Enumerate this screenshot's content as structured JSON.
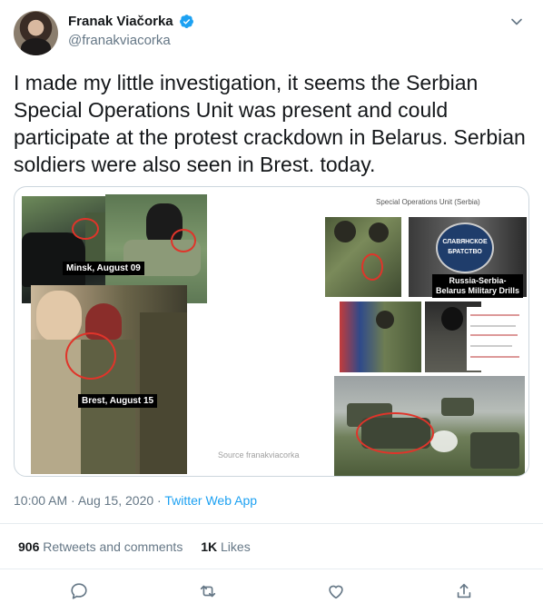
{
  "author": {
    "display_name": "Franak Viačorka",
    "handle": "@franakviacorka",
    "verified": true
  },
  "tweet": {
    "text": "I made my little investigation, it seems the Serbian Special Operations Unit was present and could participate at the protest crackdown in Belarus. Serbian soldiers were also seen in Brest. today."
  },
  "media": {
    "labels": {
      "minsk": "Minsk, August 09",
      "brest": "Brest, August 15",
      "source": "Source franakviacorka",
      "unit_title": "Special Operations Unit (Serbia)",
      "drills": "Russia-Serbia-\nBelarus Military Drills",
      "badge_top": "СЛАВЯНСКОЕ",
      "badge_bottom": "БРАТСТВО"
    }
  },
  "meta": {
    "time": "10:00 AM",
    "separator1": "·",
    "date": "Aug 15, 2020",
    "separator2": "·",
    "app": "Twitter Web App"
  },
  "stats": {
    "retweets_count": "906",
    "retweets_label": "Retweets and comments",
    "likes_count": "1K",
    "likes_label": "Likes"
  },
  "icons": {
    "verified": "verified-badge-icon",
    "caret": "chevron-down-icon",
    "reply": "reply-icon",
    "retweet": "retweet-icon",
    "like": "heart-icon",
    "share": "share-icon"
  },
  "colors": {
    "accent": "#1da1f2",
    "secondary_text": "#657786",
    "highlight": "#e0342a"
  }
}
